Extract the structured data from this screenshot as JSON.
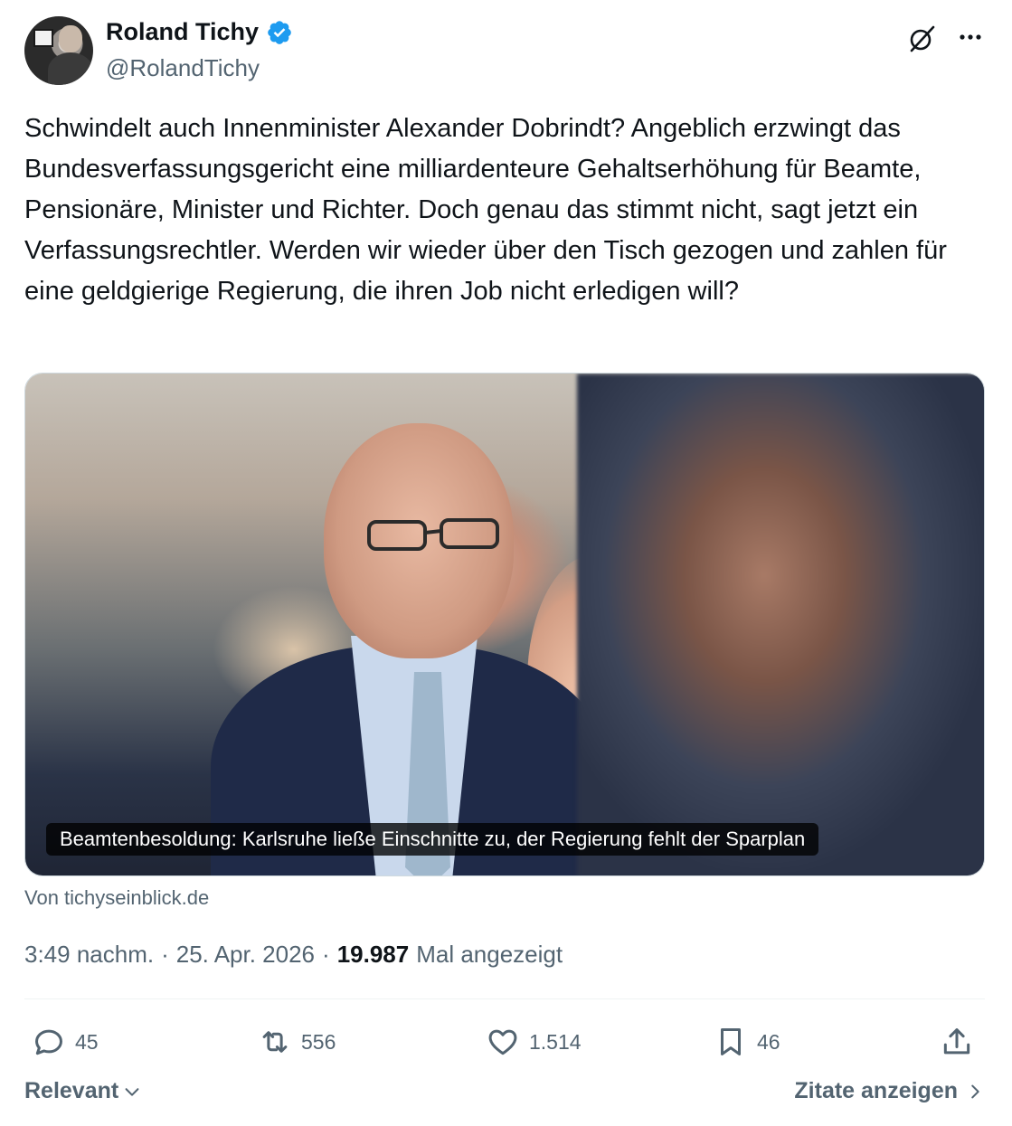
{
  "author": {
    "name": "Roland Tichy",
    "handle": "@RolandTichy",
    "verified": true
  },
  "tweet": {
    "text": "Schwindelt auch Innenminister Alexander Dobrindt? Angeblich erzwingt das Bundesverfassungsgericht eine milliardenteure Gehaltserhöhung für Beamte, Pensionäre, Minister und Richter. Doch genau das stimmt nicht, sagt jetzt ein Verfassungsrechtler. Werden wir wieder über den Tisch gezogen und zahlen für eine geldgierige Regierung, die ihren Job nicht erledigen will?"
  },
  "card": {
    "caption": "Beamtenbesoldung: Karlsruhe ließe Einschnitte zu, der Regierung fehlt der Sparplan",
    "source": "Von tichyseinblick.de"
  },
  "meta": {
    "time": "3:49 nachm.",
    "separator": "·",
    "date": "25. Apr. 2026",
    "views_count": "19.987",
    "views_label": "Mal angezeigt"
  },
  "actions": {
    "replies": "45",
    "reposts": "556",
    "likes": "1.514",
    "bookmarks": "46"
  },
  "footer": {
    "sort_label": "Relevant",
    "quotes_label": "Zitate anzeigen"
  },
  "icons": {
    "verified": "verified-badge-icon",
    "grok": "grok-icon",
    "more": "more-icon",
    "reply": "reply-icon",
    "repost": "repost-icon",
    "like": "like-icon",
    "bookmark": "bookmark-icon",
    "share": "share-icon"
  },
  "colors": {
    "text_primary": "#0f1419",
    "text_secondary": "#536471",
    "verified_blue": "#1d9bf0",
    "divider": "#eff3f4"
  }
}
